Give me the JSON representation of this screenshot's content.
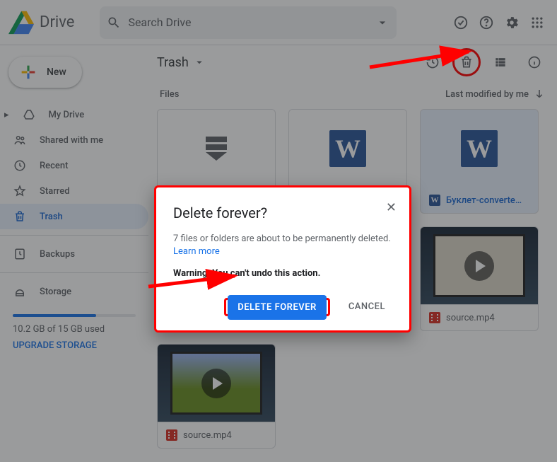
{
  "app_name": "Drive",
  "search_placeholder": "Search Drive",
  "new_button": "New",
  "nav": {
    "my_drive": "My Drive",
    "shared": "Shared with me",
    "recent": "Recent",
    "starred": "Starred",
    "trash": "Trash",
    "backups": "Backups",
    "storage": "Storage"
  },
  "storage_used": "10.2 GB of 15 GB used",
  "storage_pct": 68,
  "upgrade_link": "UPGRADE STORAGE",
  "location": "Trash",
  "section": "Files",
  "sort_label": "Last modified by me",
  "files": [
    {
      "name": "",
      "kind": "stack",
      "selected": false
    },
    {
      "name": "",
      "kind": "word",
      "selected": false
    },
    {
      "name": "Буклет-converte…",
      "kind": "word",
      "selected": true
    },
    {
      "name": "source.mp4",
      "kind": "video",
      "selected": false,
      "alt": false
    },
    {
      "name": "source.mp4",
      "kind": "video",
      "selected": false,
      "alt": false
    },
    {
      "name": "source.mp4",
      "kind": "video",
      "selected": false,
      "alt": false
    },
    {
      "name": "source.mp4",
      "kind": "video",
      "selected": false,
      "alt": true
    }
  ],
  "modal": {
    "title": "Delete forever?",
    "message": "7 files or folders are about to be permanently deleted. ",
    "learn_more": "Learn more",
    "warning": "Warning: You can't undo this action.",
    "confirm": "DELETE FOREVER",
    "cancel": "CANCEL"
  },
  "colors": {
    "accent": "#1a73e8",
    "highlight": "#ff0000"
  }
}
